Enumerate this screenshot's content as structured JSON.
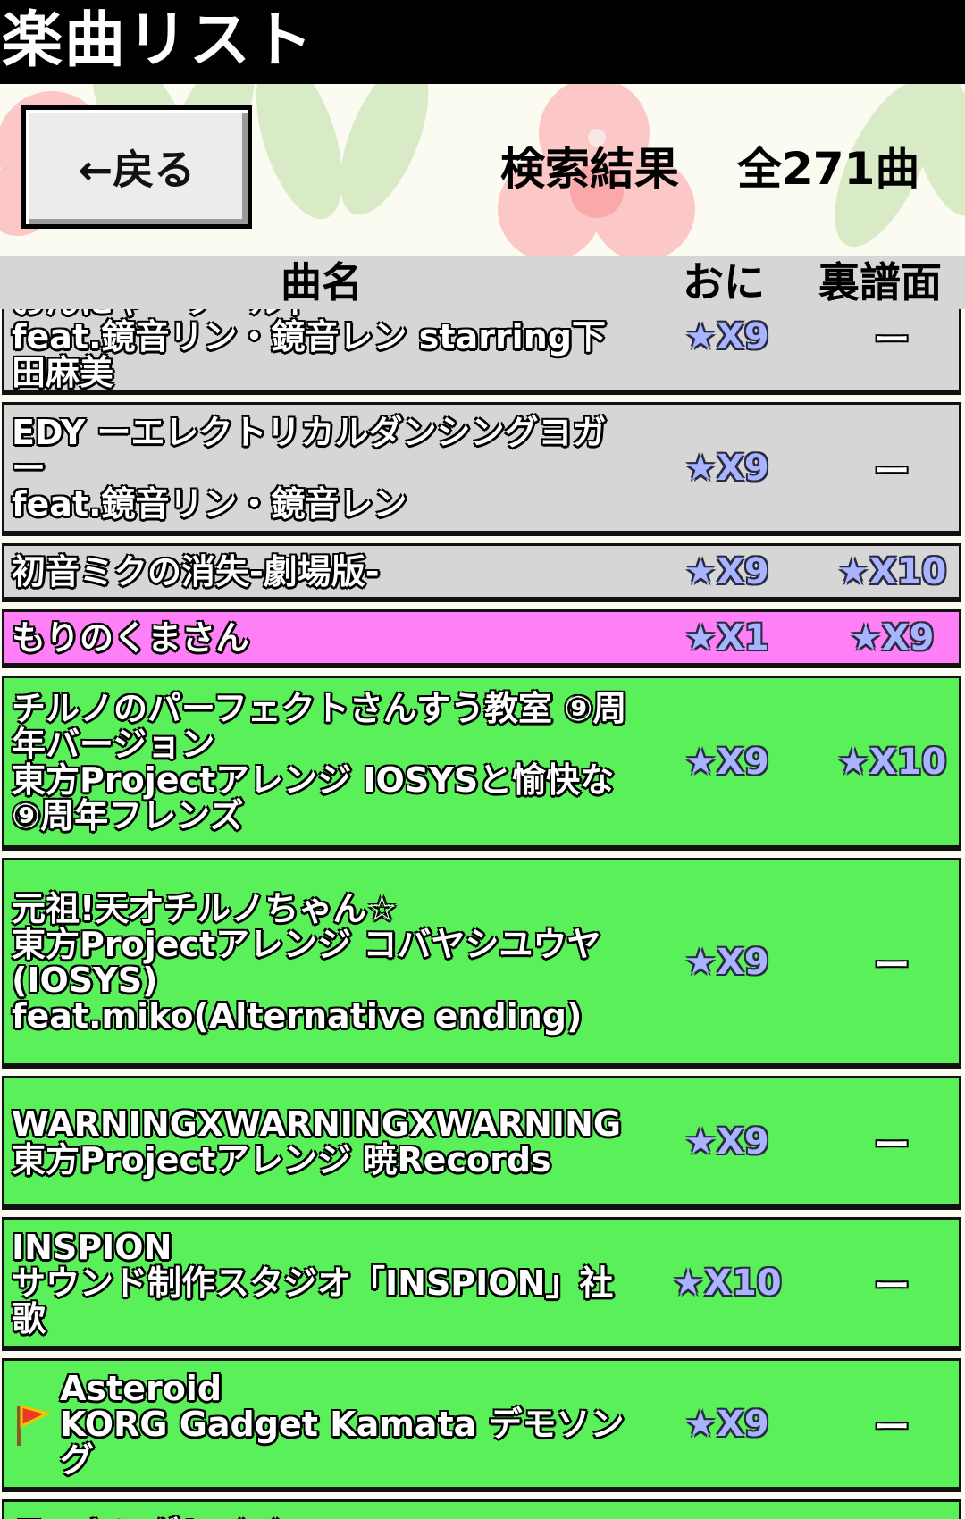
{
  "app": {
    "title": "楽曲リスト"
  },
  "header": {
    "back_label": "←戻る",
    "result_label": "検索結果",
    "result_count": "全271曲"
  },
  "columns": {
    "name": "曲名",
    "oni": "おに",
    "ura": "裏譜面"
  },
  "colors": {
    "gray_row": "#d6d6d6",
    "pink_row": "#ff80f6",
    "green_row": "#5af05a",
    "star_text": "#a8b4ff"
  },
  "songs": [
    {
      "name": "おんにゃーワールド\nfeat.鏡音リン・鏡音レン starring下田麻美",
      "oni": "★X9",
      "ura": "ー",
      "color": "gray",
      "flag": false
    },
    {
      "name": "EDY ーエレクトリカルダンシングヨガー\nfeat.鏡音リン・鏡音レン",
      "oni": "★X9",
      "ura": "ー",
      "color": "gray",
      "flag": false
    },
    {
      "name": "初音ミクの消失-劇場版-",
      "oni": "★X9",
      "ura": "★X10",
      "color": "gray",
      "flag": false
    },
    {
      "name": "もりのくまさん",
      "oni": "★X1",
      "ura": "★X9",
      "color": "pink",
      "flag": false
    },
    {
      "name": "チルノのパーフェクトさんすう教室 ⑨周年バージョン\n東方Projectアレンジ IOSYSと愉快な⑨周年フレンズ",
      "oni": "★X9",
      "ura": "★X10",
      "color": "green",
      "flag": false
    },
    {
      "name": "元祖!天才チルノちゃん☆\n東方Projectアレンジ コバヤシユウヤ(IOSYS)\nfeat.miko(Alternative ending)",
      "oni": "★X9",
      "ura": "ー",
      "color": "green",
      "flag": false
    },
    {
      "name": "WARNINGXWARNINGXWARNING\n東方Projectアレンジ 暁Records",
      "oni": "★X9",
      "ura": "ー",
      "color": "green",
      "flag": false
    },
    {
      "name": "INSPION\nサウンド制作スタジオ「INSPION」社歌",
      "oni": "★X10",
      "ura": "ー",
      "color": "green",
      "flag": false
    },
    {
      "name": "Asteroid\nKORG Gadget Kamata デモソング",
      "oni": "★X9",
      "ura": "ー",
      "color": "green",
      "flag": true
    },
    {
      "name": "ラッキングレイイ",
      "oni": "",
      "ura": "",
      "color": "green",
      "flag": false
    }
  ]
}
